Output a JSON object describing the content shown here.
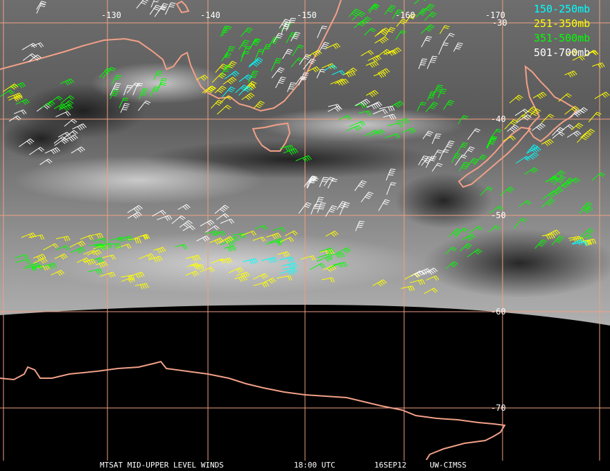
{
  "legend": [
    {
      "label": "150-250mb",
      "color": "#00ffff"
    },
    {
      "label": "251-350mb",
      "color": "#ffff00"
    },
    {
      "label": "351-500mb",
      "color": "#00ff00"
    },
    {
      "label": "501-700mb",
      "color": "#ffffff"
    }
  ],
  "longitude_labels": [
    "-130",
    "-140",
    "-150",
    "-160",
    "-170"
  ],
  "latitude_labels": [
    "-30",
    "-40",
    "-50",
    "-60",
    "-70"
  ],
  "footer": {
    "product": "MTSAT MID-UPPER LEVEL WINDS",
    "time": "18:00 UTC",
    "date": "16SEP12",
    "credit": "UW-CIMSS"
  },
  "colors": {
    "grid": "#f0a080",
    "coastline": "#f2a088",
    "background_space": "#000000"
  }
}
